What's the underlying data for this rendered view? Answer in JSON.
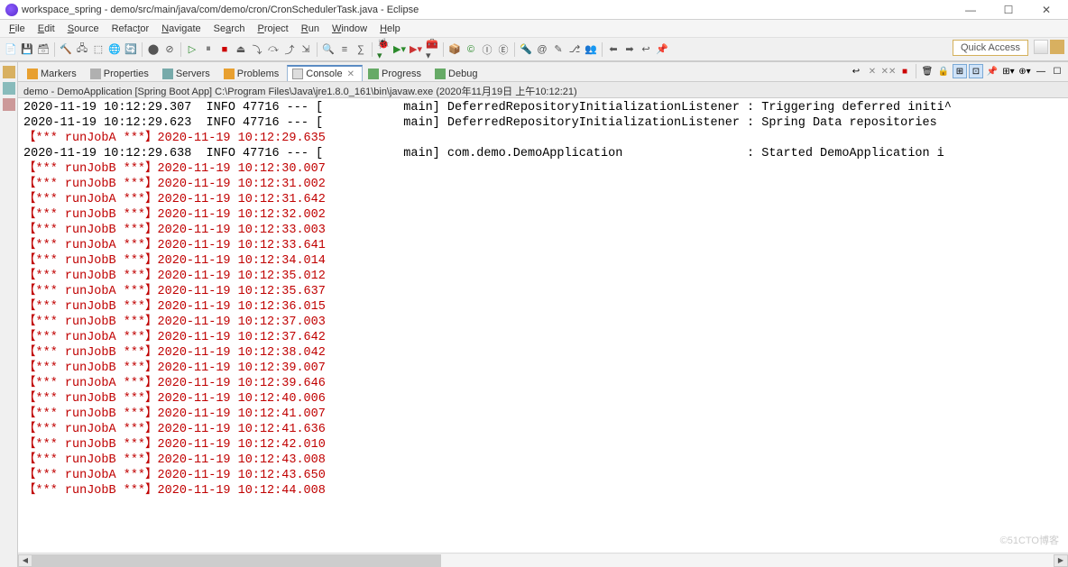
{
  "window": {
    "title": "workspace_spring - demo/src/main/java/com/demo/cron/CronSchedulerTask.java - Eclipse"
  },
  "menu": [
    "File",
    "Edit",
    "Source",
    "Refactor",
    "Navigate",
    "Search",
    "Project",
    "Run",
    "Window",
    "Help"
  ],
  "quick_access": "Quick Access",
  "tabs": [
    {
      "label": "Markers",
      "active": false
    },
    {
      "label": "Properties",
      "active": false
    },
    {
      "label": "Servers",
      "active": false
    },
    {
      "label": "Problems",
      "active": false
    },
    {
      "label": "Console",
      "active": true
    },
    {
      "label": "Progress",
      "active": false
    },
    {
      "label": "Debug",
      "active": false
    }
  ],
  "launch_desc": "demo - DemoApplication [Spring Boot App] C:\\Program Files\\Java\\jre1.8.0_161\\bin\\javaw.exe (2020年11月19日 上午10:12:21)",
  "console_lines": [
    {
      "t": "out",
      "text": "2020-11-19 10:12:29.307  INFO 47716 --- [           main] DeferredRepositoryInitializationListener : Triggering deferred initi^"
    },
    {
      "t": "out",
      "text": "2020-11-19 10:12:29.623  INFO 47716 --- [           main] DeferredRepositoryInitializationListener : Spring Data repositories "
    },
    {
      "t": "err",
      "text": "【*** runJobA ***】2020-11-19 10:12:29.635"
    },
    {
      "t": "out",
      "text": "2020-11-19 10:12:29.638  INFO 47716 --- [           main] com.demo.DemoApplication                 : Started DemoApplication i"
    },
    {
      "t": "err",
      "text": "【*** runJobB ***】2020-11-19 10:12:30.007"
    },
    {
      "t": "err",
      "text": "【*** runJobB ***】2020-11-19 10:12:31.002"
    },
    {
      "t": "err",
      "text": "【*** runJobA ***】2020-11-19 10:12:31.642"
    },
    {
      "t": "err",
      "text": "【*** runJobB ***】2020-11-19 10:12:32.002"
    },
    {
      "t": "err",
      "text": "【*** runJobB ***】2020-11-19 10:12:33.003"
    },
    {
      "t": "err",
      "text": "【*** runJobA ***】2020-11-19 10:12:33.641"
    },
    {
      "t": "err",
      "text": "【*** runJobB ***】2020-11-19 10:12:34.014"
    },
    {
      "t": "err",
      "text": "【*** runJobB ***】2020-11-19 10:12:35.012"
    },
    {
      "t": "err",
      "text": "【*** runJobA ***】2020-11-19 10:12:35.637"
    },
    {
      "t": "err",
      "text": "【*** runJobB ***】2020-11-19 10:12:36.015"
    },
    {
      "t": "err",
      "text": "【*** runJobB ***】2020-11-19 10:12:37.003"
    },
    {
      "t": "err",
      "text": "【*** runJobA ***】2020-11-19 10:12:37.642"
    },
    {
      "t": "err",
      "text": "【*** runJobB ***】2020-11-19 10:12:38.042"
    },
    {
      "t": "err",
      "text": "【*** runJobB ***】2020-11-19 10:12:39.007"
    },
    {
      "t": "err",
      "text": "【*** runJobA ***】2020-11-19 10:12:39.646"
    },
    {
      "t": "err",
      "text": "【*** runJobB ***】2020-11-19 10:12:40.006"
    },
    {
      "t": "err",
      "text": "【*** runJobB ***】2020-11-19 10:12:41.007"
    },
    {
      "t": "err",
      "text": "【*** runJobA ***】2020-11-19 10:12:41.636"
    },
    {
      "t": "err",
      "text": "【*** runJobB ***】2020-11-19 10:12:42.010"
    },
    {
      "t": "err",
      "text": "【*** runJobB ***】2020-11-19 10:12:43.008"
    },
    {
      "t": "err",
      "text": "【*** runJobA ***】2020-11-19 10:12:43.650"
    },
    {
      "t": "err",
      "text": "【*** runJobB ***】2020-11-19 10:12:44.008"
    }
  ],
  "watermark": "©51CTO博客"
}
